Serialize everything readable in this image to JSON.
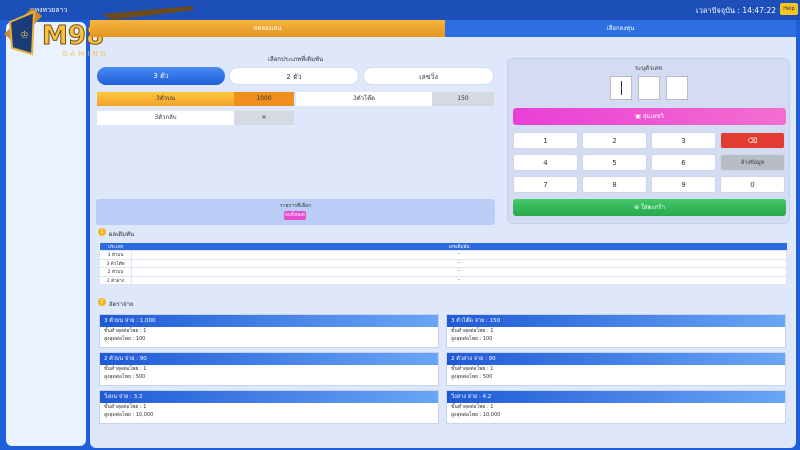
{
  "topbar": {
    "title": "แทงหวยลาว",
    "time": "เวลาปัจจุบัน : 14:47:22",
    "menu_label": "Help"
  },
  "logo": {
    "text": "M98",
    "subtitle": "GAMING"
  },
  "tabs": [
    "ทดลองเล่น",
    "เลือกลงทุน"
  ],
  "bet_type": {
    "heading": "เลือกประเภทที่เดิมพัน",
    "options": [
      "3 ตัว",
      "2 ตัว",
      "เลขวิ่ง"
    ]
  },
  "bets": [
    {
      "label": "3ตัวบน",
      "value": "1000"
    },
    {
      "label": "3ตัวโต๊ด",
      "value": "150"
    },
    {
      "label": "3ตัวกลับ",
      "value": "✕"
    }
  ],
  "numpad": {
    "heading": "ระบุตัวเลข",
    "random_btn": "สุ่มเลขวิ",
    "keys": [
      "1",
      "2",
      "3",
      "4",
      "5",
      "6",
      "7",
      "8",
      "9",
      "0"
    ],
    "delete_btn": "ลบ",
    "clear_btn": "ล้างข้อมูล",
    "submit_btn": "ใส่ตะกร้า"
  },
  "info_box": {
    "text": "รายการที่เลือก",
    "button": "ลบทั้งหมด"
  },
  "results": {
    "heading": "ผลเดิมพัน",
    "columns": [
      "ประเภท",
      "เลขเดิมพัน"
    ],
    "rows": [
      [
        "3 ตัวบน",
        "–"
      ],
      [
        "3 ตัวโต๊ด",
        "–"
      ],
      [
        "2 ตัวบน",
        "–"
      ],
      [
        "2 ตัวล่าง",
        "–"
      ]
    ]
  },
  "payouts": {
    "heading": "อัตราจ่าย",
    "cards": [
      {
        "title": "3 ตัวบน จ่าย : 1,000",
        "min": "ขั้นต่ำสุดต่อโพย : 1",
        "max": "สูงสุดต่อโพย : 100"
      },
      {
        "title": "3 ตัวโต๊ด จ่าย : 150",
        "min": "ขั้นต่ำสุดต่อโพย : 1",
        "max": "สูงสุดต่อโพย : 100"
      },
      {
        "title": "2 ตัวบน จ่าย : 90",
        "min": "ขั้นต่ำสุดต่อโพย : 1",
        "max": "สูงสุดต่อโพย : 500"
      },
      {
        "title": "2 ตัวล่าง จ่าย : 90",
        "min": "ขั้นต่ำสุดต่อโพย : 1",
        "max": "สูงสุดต่อโพย : 500"
      },
      {
        "title": "วิ่งบน จ่าย : 3.2",
        "min": "ขั้นต่ำสุดต่อโพย : 1",
        "max": "สูงสุดต่อโพย : 10,000"
      },
      {
        "title": "วิ่งล่าง จ่าย : 4.2",
        "min": "ขั้นต่ำสุดต่อโพย : 1",
        "max": "สูงสุดต่อโพย : 10,000"
      }
    ]
  }
}
